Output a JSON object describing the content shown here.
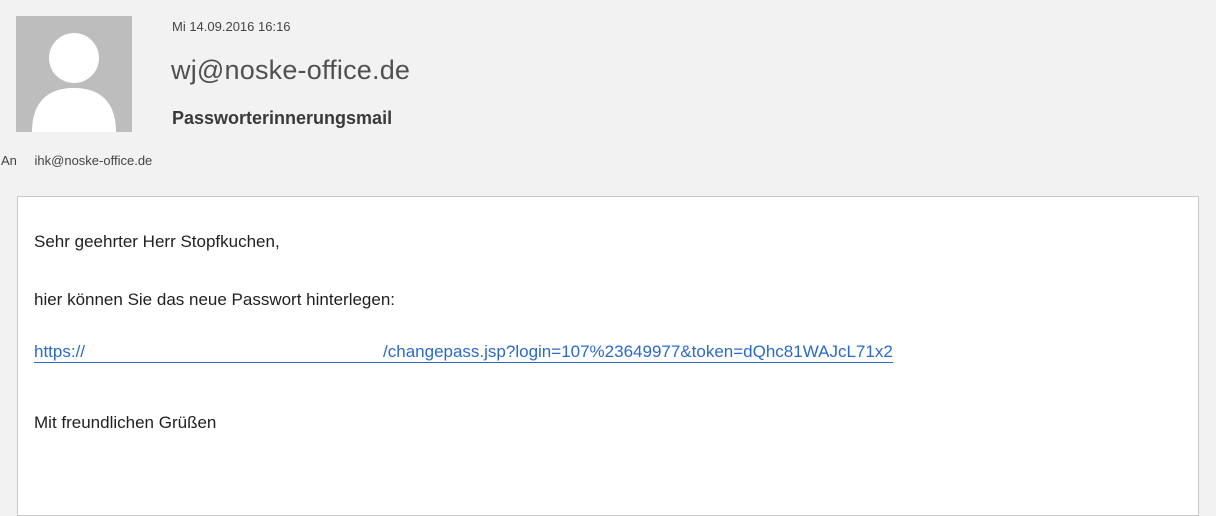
{
  "header": {
    "date": "Mi 14.09.2016 16:16",
    "sender": "wj@noske-office.de",
    "subject": "Passworterinnerungsmail",
    "to_label": "An",
    "recipient": "ihk@noske-office.de",
    "avatar_icon": "person-silhouette-icon"
  },
  "body": {
    "greeting": "Sehr geehrter Herr Stopfkuchen,",
    "intro": "hier können Sie das neue Passwort hinterlegen:",
    "link_prefix": "https://",
    "link_suffix": "/changepass.jsp?login=107%23649977&token=dQhc81WAJcL71x2",
    "closing": "Mit freundlichen Grüßen"
  },
  "colors": {
    "link": "#2b6bc7",
    "header_bg": "#f2f2f2",
    "avatar_bg": "#bdbdbd"
  }
}
